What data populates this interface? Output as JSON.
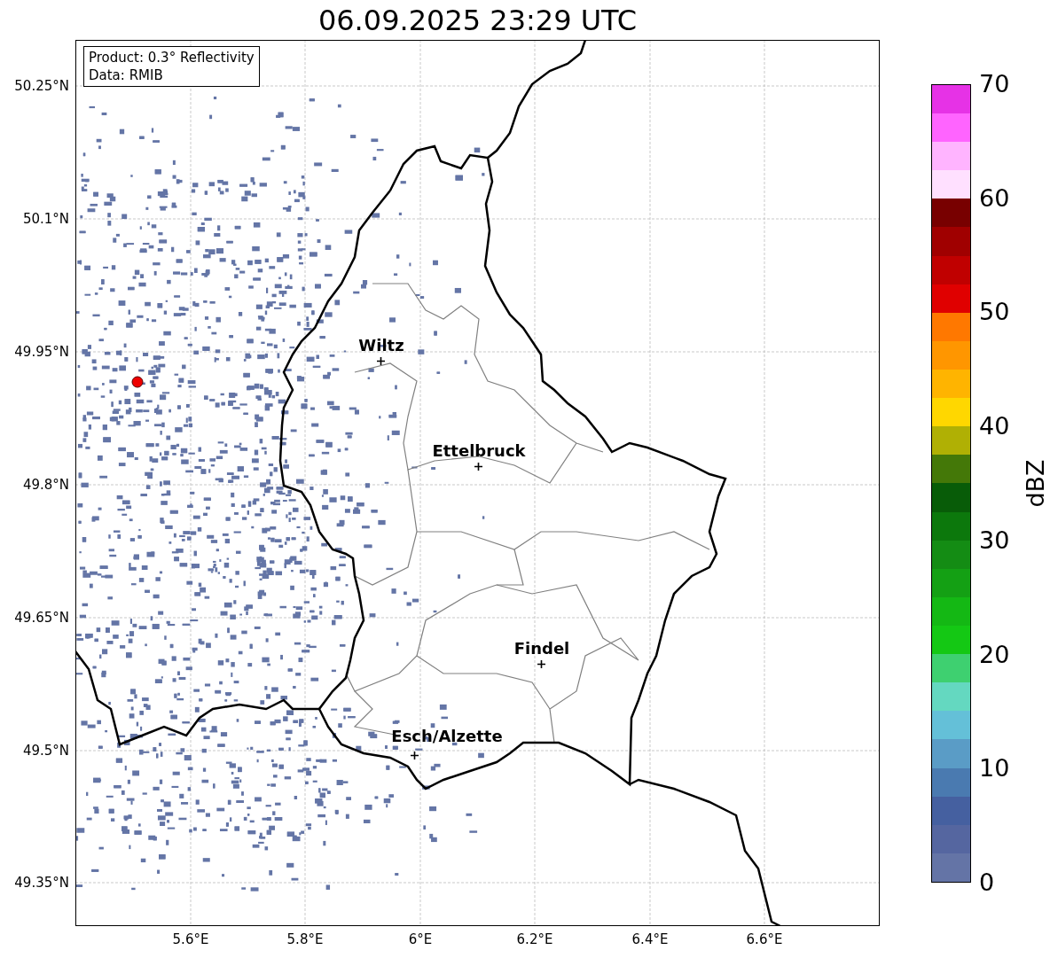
{
  "title": "06.09.2025 23:29 UTC",
  "info_box": [
    "Product: 0.3° Reflectivity",
    "Data: RMIB"
  ],
  "y_ticks": [
    "50.25°N",
    "50.1°N",
    "49.95°N",
    "49.8°N",
    "49.65°N",
    "49.5°N",
    "49.35°N"
  ],
  "x_ticks": [
    "5.6°E",
    "5.8°E",
    "6°E",
    "6.2°E",
    "6.4°E",
    "6.6°E"
  ],
  "cities": [
    {
      "name": "Wiltz"
    },
    {
      "name": "Ettelbruck"
    },
    {
      "name": "Findel"
    },
    {
      "name": "Esch/Alzette"
    }
  ],
  "colorbar": {
    "label": "dBZ",
    "ticks": [
      "70",
      "60",
      "50",
      "40",
      "30",
      "20",
      "10",
      "0"
    ],
    "segments": [
      {
        "color": "#6474a6"
      },
      {
        "color": "#5566a0"
      },
      {
        "color": "#4560a0"
      },
      {
        "color": "#4a7ab0"
      },
      {
        "color": "#5a9cc6"
      },
      {
        "color": "#64c0d8"
      },
      {
        "color": "#64d8c0"
      },
      {
        "color": "#3ed070"
      },
      {
        "color": "#14c814"
      },
      {
        "color": "#14b814"
      },
      {
        "color": "#14a014"
      },
      {
        "color": "#148c14"
      },
      {
        "color": "#0c780c"
      },
      {
        "color": "#085c08"
      },
      {
        "color": "#447808"
      },
      {
        "color": "#b0b004"
      },
      {
        "color": "#ffd700"
      },
      {
        "color": "#ffb400"
      },
      {
        "color": "#ff9600"
      },
      {
        "color": "#ff7800"
      },
      {
        "color": "#e00000"
      },
      {
        "color": "#c00000"
      },
      {
        "color": "#a00000"
      },
      {
        "color": "#780000"
      },
      {
        "color": "#ffe0ff"
      },
      {
        "color": "#ffb4ff"
      },
      {
        "color": "#ff64ff"
      },
      {
        "color": "#e632e6"
      }
    ]
  }
}
